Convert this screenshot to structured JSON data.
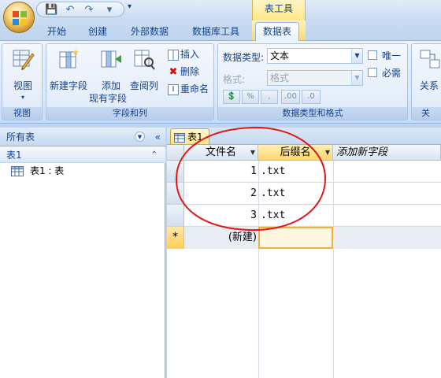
{
  "quick_access": {
    "save": "💾",
    "undo": "↶",
    "redo": "↷",
    "more": "▾"
  },
  "contextual": {
    "title": "表工具"
  },
  "tabs": [
    "开始",
    "创建",
    "外部数据",
    "数据库工具",
    "数据表"
  ],
  "ribbon": {
    "views": {
      "view_label": "视图",
      "group_label": "视图"
    },
    "fields": {
      "new_field": "新建字段",
      "add_existing_line1": "添加",
      "add_existing_line2": "现有字段",
      "lookup_column": "查阅列",
      "insert": "插入",
      "delete": "删除",
      "rename": "重命名",
      "group_label": "字段和列"
    },
    "datatype": {
      "type_label": "数据类型:",
      "type_value": "文本",
      "format_label": "格式:",
      "format_value": "格式",
      "unique": "唯一",
      "required": "必需",
      "currency": "💲",
      "percent": "%",
      "comma": ",",
      "inc_decimal": ".00",
      "dec_decimal": ".0",
      "group_label": "数据类型和格式"
    },
    "relations": {
      "label": "关系",
      "group_label_partial": "关"
    }
  },
  "nav": {
    "header": "所有表",
    "group": "表1",
    "item": "表1 : 表"
  },
  "document": {
    "tab": "表1",
    "columns": [
      "文件名",
      "后缀名",
      "添加新字段"
    ],
    "rows": [
      {
        "name": "1",
        "ext": ".txt"
      },
      {
        "name": "2",
        "ext": ".txt"
      },
      {
        "name": "3",
        "ext": ".txt"
      }
    ],
    "new_row_marker": "*",
    "new_row_label": "(新建)"
  },
  "colors": {
    "accent": "#ffd66b",
    "annotation": "#e01818",
    "ribbon_blue": "#15428b"
  }
}
